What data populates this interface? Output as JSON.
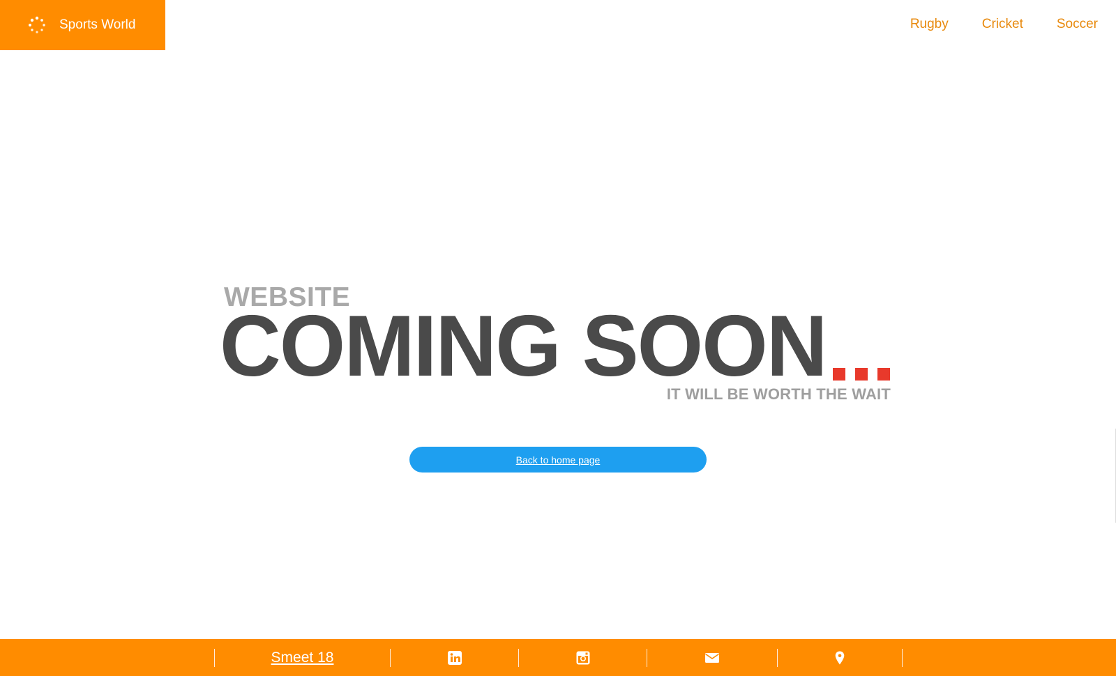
{
  "brand": {
    "name": "Sports World",
    "icon": "spinner-dots-icon",
    "color": "#ff8c00"
  },
  "nav": {
    "items": [
      {
        "label": "Rugby"
      },
      {
        "label": "Cricket"
      },
      {
        "label": "Soccer"
      }
    ],
    "color": "#e8890c"
  },
  "hero": {
    "kicker": "WEBSITE",
    "headline": "COMING SOON",
    "tagline": "IT WILL BE WORTH THE WAIT",
    "dot_color": "#e8392b"
  },
  "home_button": {
    "label": "Back to home page",
    "color": "#1e9ff0"
  },
  "footer": {
    "link_label": "Smeet 18",
    "icons": [
      "linkedin-icon",
      "instagram-icon",
      "mail-icon",
      "location-pin-icon"
    ],
    "color": "#ff8c00"
  }
}
